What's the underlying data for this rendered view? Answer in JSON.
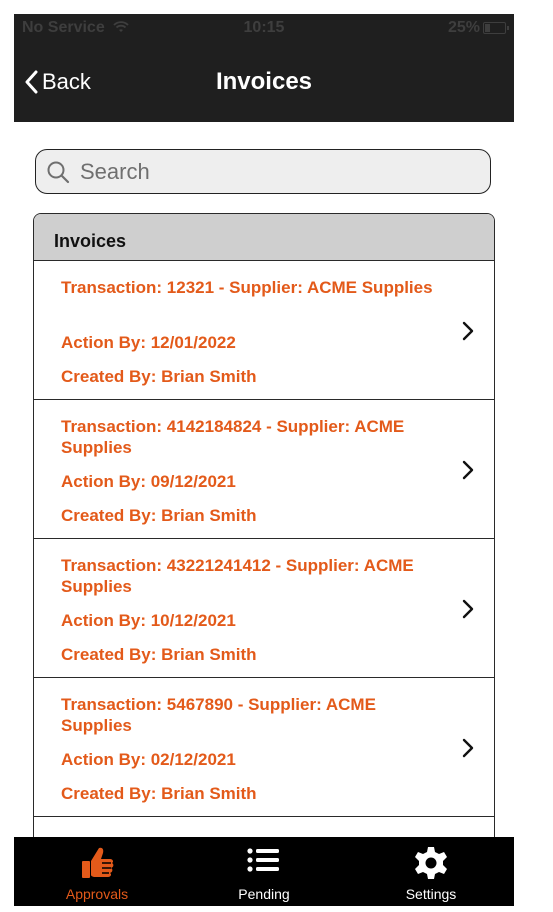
{
  "status_bar": {
    "carrier": "No Service",
    "time": "10:15",
    "battery": "25%"
  },
  "nav": {
    "back_label": "Back",
    "title": "Invoices"
  },
  "search": {
    "placeholder": "Search"
  },
  "list": {
    "header": "Invoices",
    "items": [
      {
        "transaction": "Transaction: 12321 - Supplier: ACME Supplies",
        "action_by": "Action By: 12/01/2022",
        "created_by": "Created By: Brian Smith"
      },
      {
        "transaction": "Transaction: 4142184824 - Supplier: ACME Supplies",
        "action_by": "Action By: 09/12/2021",
        "created_by": "Created By: Brian Smith"
      },
      {
        "transaction": "Transaction: 43221241412 - Supplier: ACME Supplies",
        "action_by": "Action By: 10/12/2021",
        "created_by": "Created By: Brian Smith"
      },
      {
        "transaction": "Transaction: 5467890 - Supplier: ACME Supplies",
        "action_by": "Action By: 02/12/2021",
        "created_by": "Created By: Brian Smith"
      }
    ]
  },
  "tabs": [
    {
      "label": "Approvals",
      "icon": "thumbs-up-icon",
      "active": true
    },
    {
      "label": "Pending",
      "icon": "list-icon",
      "active": false
    },
    {
      "label": "Settings",
      "icon": "gear-icon",
      "active": false
    }
  ],
  "colors": {
    "accent": "#e35a1a",
    "bar": "#1f1f1f",
    "tabbar": "#000000"
  }
}
